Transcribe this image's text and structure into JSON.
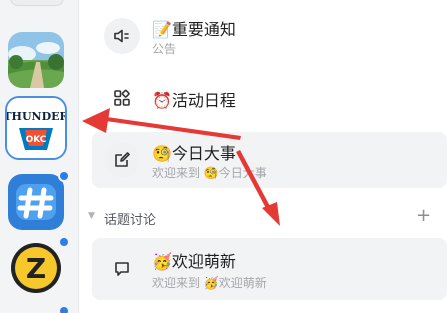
{
  "servers": [
    {
      "name": "landscape-server"
    },
    {
      "name": "thunder-server",
      "label": "THUNDER",
      "sub_label": "OKC"
    },
    {
      "name": "hash-server"
    },
    {
      "name": "z-server",
      "label": "Z"
    }
  ],
  "channels": {
    "announcement": {
      "icon": "speaker-icon",
      "emoji": "📝",
      "name": "重要通知",
      "sub": "公告"
    },
    "schedule": {
      "icon": "grid-icon",
      "emoji": "⏰",
      "name": "活动日程"
    },
    "news": {
      "icon": "edit-icon",
      "emoji": "🧐",
      "name": "今日大事",
      "sub_prefix": "欢迎来到",
      "sub_emoji": "🧐",
      "sub_name": "今日大事"
    },
    "welcome": {
      "icon": "chat-icon",
      "emoji": "🥳",
      "name": "欢迎萌新",
      "sub_prefix": "欢迎来到",
      "sub_emoji": "🥳",
      "sub_name": "欢迎萌新"
    }
  },
  "section": {
    "caret": "▼",
    "label": "话题讨论",
    "add": "+"
  },
  "colors": {
    "accent": "#2b7de9",
    "annotation": "#e53935",
    "active_row": "#f2f3f5"
  }
}
